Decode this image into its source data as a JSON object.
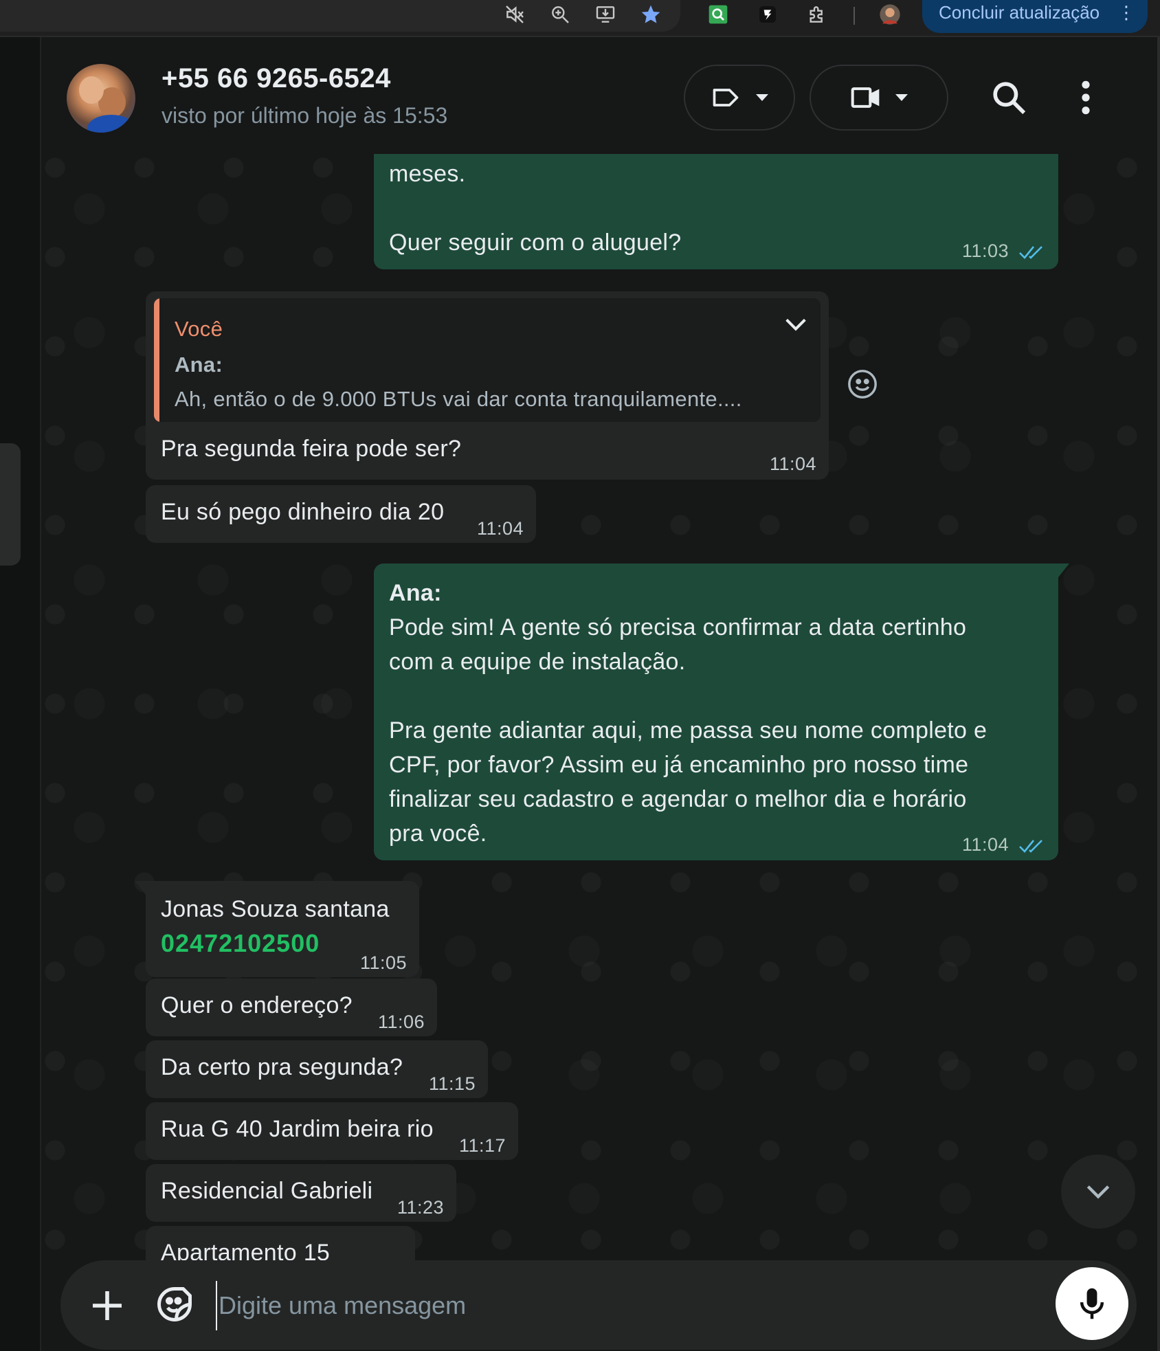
{
  "browser": {
    "update_button": "Concluir atualização",
    "icons": [
      "mute-icon",
      "zoom-icon",
      "install-app-icon",
      "bookmark-star-icon",
      "extension-search-icon",
      "extension-f-icon",
      "extensions-puzzle-icon",
      "profile-avatar"
    ]
  },
  "header": {
    "contact_name": "+55 66 9265-6524",
    "status": "visto por último hoje às 15:53"
  },
  "messages": [
    {
      "direction": "out",
      "text_line1": "meses.",
      "text_line2": "Quer seguir com o aluguel?",
      "time": "11:03"
    },
    {
      "direction": "in",
      "quote": {
        "author": "Você",
        "sender": "Ana:",
        "text": "Ah, então o de 9.000 BTUs vai dar conta tranquilamente...."
      },
      "text": "Pra segunda feira pode ser?",
      "time": "11:04"
    },
    {
      "direction": "in",
      "text": "Eu só pego dinheiro dia 20",
      "time": "11:04"
    },
    {
      "direction": "out",
      "sender": "Ana:",
      "lines": [
        "Pode sim! A gente só precisa confirmar a data certinho",
        "com a equipe de instalação.",
        "",
        "Pra gente adiantar aqui, me passa seu nome completo e",
        "CPF, por favor? Assim eu já encaminho pro nosso time",
        "finalizar seu cadastro e agendar o melhor dia e horário",
        "pra você."
      ],
      "time": "11:04"
    },
    {
      "direction": "in",
      "text": "Jonas Souza santana",
      "number": "02472102500",
      "time": "11:05"
    },
    {
      "direction": "in",
      "text": "Quer o endereço?",
      "time": "11:06"
    },
    {
      "direction": "in",
      "text": "Da certo pra segunda?",
      "time": "11:15"
    },
    {
      "direction": "in",
      "text": "Rua G 40 Jardim beira rio",
      "time": "11:17"
    },
    {
      "direction": "in",
      "text": "Residencial Gabrieli",
      "time": "11:23"
    },
    {
      "direction": "in",
      "text": "Apartamento 15",
      "time": ""
    }
  ],
  "composer": {
    "placeholder": "Digite uma mensagem"
  },
  "colors": {
    "outgoing_bubble": "#1e4a3a",
    "incoming_bubble": "#242626",
    "link_green": "#21c063",
    "quote_accent": "#e88a6a",
    "read_ticks": "#53bdeb"
  }
}
